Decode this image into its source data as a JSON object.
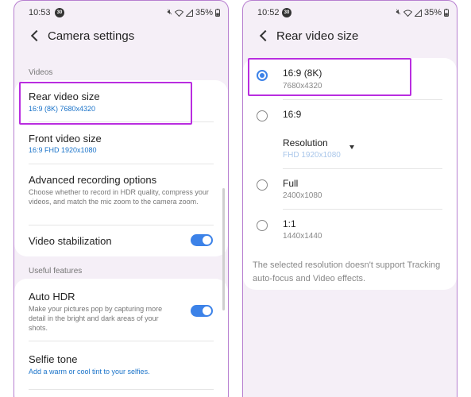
{
  "left": {
    "status": {
      "time": "10:53",
      "notification": "30",
      "battery": "35%"
    },
    "header": {
      "title": "Camera settings"
    },
    "sections": {
      "videos": "Videos",
      "useful": "Useful features"
    },
    "rear_video": {
      "title": "Rear video size",
      "value": "16:9 (8K) 7680x4320"
    },
    "front_video": {
      "title": "Front video size",
      "value": "16:9 FHD 1920x1080"
    },
    "advanced": {
      "title": "Advanced recording options",
      "desc": "Choose whether to record in HDR quality, compress your videos, and match the mic zoom to the camera zoom."
    },
    "stabilization": {
      "title": "Video stabilization",
      "on": true
    },
    "auto_hdr": {
      "title": "Auto HDR",
      "desc": "Make your pictures pop by capturing more detail in the bright and dark areas of your shots.",
      "on": true
    },
    "selfie_tone": {
      "title": "Selfie tone",
      "desc": "Add a warm or cool tint to your selfies."
    }
  },
  "right": {
    "status": {
      "time": "10:52",
      "notification": "30",
      "battery": "35%"
    },
    "header": {
      "title": "Rear video size"
    },
    "options": {
      "opt1": {
        "title": "16:9 (8K)",
        "sub": "7680x4320",
        "selected": true
      },
      "opt2": {
        "title": "16:9",
        "selected": false
      },
      "resolution": {
        "label": "Resolution",
        "value": "FHD 1920x1080"
      },
      "opt3": {
        "title": "Full",
        "sub": "2400x1080",
        "selected": false
      },
      "opt4": {
        "title": "1:1",
        "sub": "1440x1440",
        "selected": false
      }
    },
    "note": "The selected resolution doesn't support Tracking auto-focus and Video effects."
  },
  "colors": {
    "accent": "#3c82e8",
    "highlight": "#b92de0",
    "link": "#1a73c9",
    "background": "#f5eff7"
  }
}
